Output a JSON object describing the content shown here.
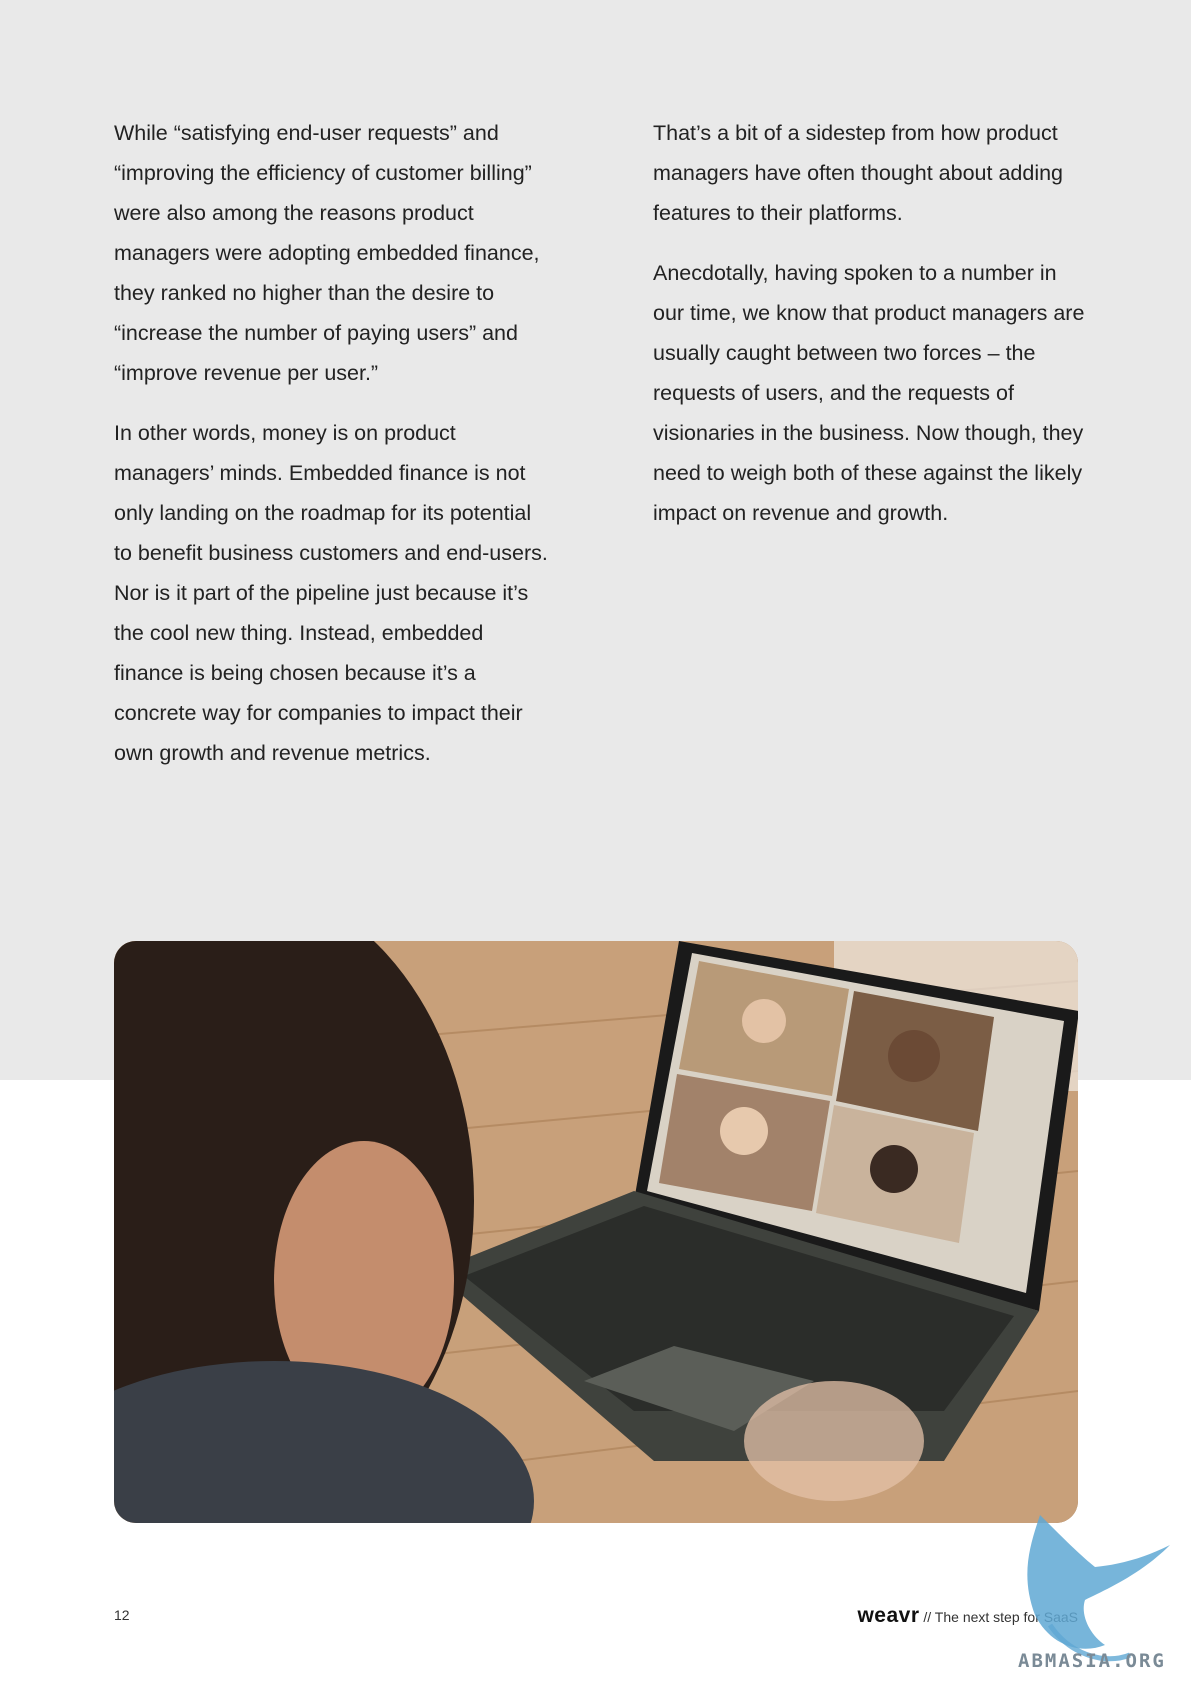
{
  "left_column": {
    "p1": "While “satisfying end-user requests” and “improving the efficiency of customer billing” were also among the reasons product managers were adopting embedded finance, they ranked no higher than the desire to “increase the number of paying users” and “improve revenue per user.”",
    "p2": "In other words, money is on product managers’ minds. Embedded finance is not only landing on the roadmap for its potential to benefit business customers and end-users. Nor is it part of the pipeline just because it’s the cool new thing. Instead, embedded finance is being chosen because it’s a concrete way for companies to impact their own growth and revenue metrics."
  },
  "right_column": {
    "p1": "That’s a bit of a sidestep from how product managers have often thought about adding features to their platforms.",
    "p2": "Anecdotally, having spoken to a number in our time, we know that product managers are usually caught between two forces – the requests of users, and the requests of visionaries in the business. Now though, they need to weigh both of these against the likely impact on revenue and growth."
  },
  "footer": {
    "page_number": "12",
    "brand": "weavr",
    "tagline": "// The next step for SaaS"
  },
  "watermark": {
    "text": "ABMASIA.ORG"
  },
  "colors": {
    "band": "#e9e9e9",
    "text": "#222222",
    "watermark": "#5fa8d3"
  }
}
